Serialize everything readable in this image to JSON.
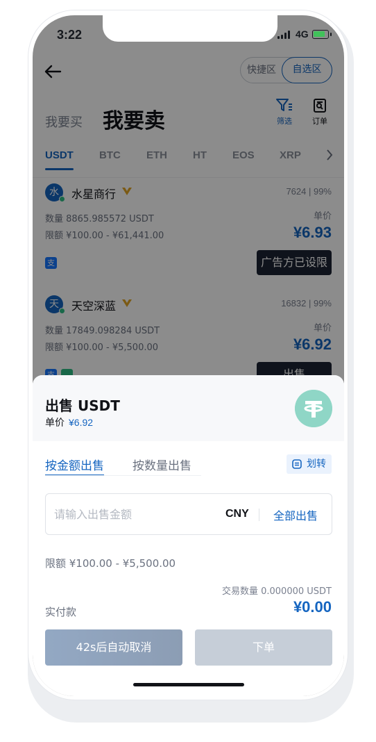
{
  "status_bar": {
    "time": "3:22",
    "network": "4G"
  },
  "header": {
    "zones": [
      "快捷区",
      "自选区"
    ],
    "tab_buy": "我要买",
    "tab_sell": "我要卖",
    "filter_label": "筛选",
    "orders_label": "订单"
  },
  "coin_tabs": [
    "USDT",
    "BTC",
    "ETH",
    "HT",
    "EOS",
    "XRP"
  ],
  "merchants": [
    {
      "avatar": "水",
      "name": "水星商行",
      "orders": "7624",
      "rate": "99%",
      "quantity": "数量 8865.985572 USDT",
      "limit": "限额 ¥100.00 - ¥61,441.00",
      "price_label": "单价",
      "price": "¥6.93",
      "pay_icon": "支",
      "action": "广告方已设限"
    },
    {
      "avatar": "天",
      "name": "天空深蓝",
      "orders": "16832",
      "rate": "99%",
      "quantity": "数量 17849.098284 USDT",
      "limit": "限额 ¥100.00 - ¥5,500.00",
      "price_label": "单价",
      "price": "¥6.92",
      "pay_icon": "支",
      "action": "出售"
    }
  ],
  "sheet": {
    "title": "出售 USDT",
    "unit_price_label": "单价",
    "unit_price": "¥6.92",
    "mode_amount": "按金额出售",
    "mode_quantity": "按数量出售",
    "transfer": "划转",
    "amount_placeholder": "请输入出售金额",
    "currency": "CNY",
    "sell_all": "全部出售",
    "limit": "限额 ¥100.00 - ¥5,500.00",
    "trade_volume": "交易数量 0.000000 USDT",
    "paid_label": "实付款",
    "paid_amount": "¥0.00",
    "cancel_button": "42s后自动取消",
    "order_button": "下单"
  },
  "colors": {
    "accent": "#1565c0",
    "tether": "#8fd6c6",
    "dark_button": "#1d2433"
  }
}
